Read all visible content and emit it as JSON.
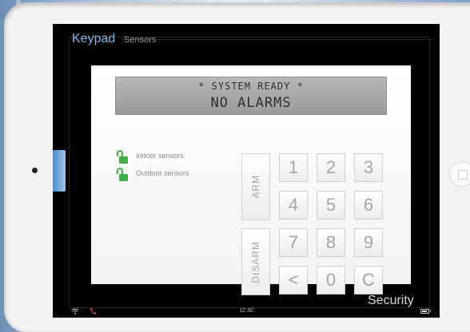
{
  "tabs": {
    "keypad": "Keypad",
    "sensors": "Sensors"
  },
  "display": {
    "line1": "* SYSTEM READY *",
    "line2": "NO ALARMS"
  },
  "sensors": [
    {
      "label": "Indoor sensors",
      "icon": "unlocked-padlock-icon",
      "color": "#3fae46"
    },
    {
      "label": "Outdoor sensors",
      "icon": "unlocked-padlock-icon",
      "color": "#3fae46"
    }
  ],
  "buttons": {
    "arm": "ARM",
    "disarm": "DISARM"
  },
  "keys": [
    "1",
    "2",
    "3",
    "4",
    "5",
    "6",
    "7",
    "8",
    "9",
    "<",
    "0",
    "C"
  ],
  "footer": {
    "title": "Security"
  },
  "status_bar": {
    "time": "12:30",
    "battery_level": 0.85
  },
  "colors": {
    "accent": "#7fb6e6",
    "lock": "#3fae46",
    "call": "#e04040"
  }
}
